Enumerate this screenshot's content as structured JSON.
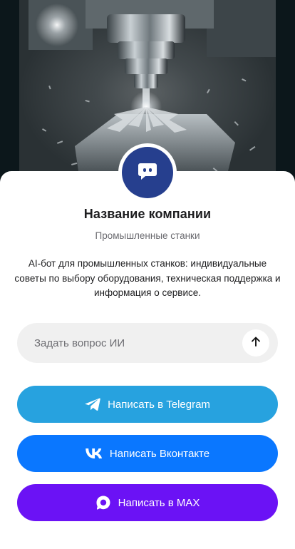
{
  "profile": {
    "company_name": "Название компании",
    "subtitle": "Промышленные станки",
    "description": "AI-бот для промышленных станков: индивидуальные советы по выбору оборудования, техническая поддержка и информация о сервисе.",
    "avatar_icon": "chat-bot-icon"
  },
  "hero": {
    "image": "cnc-milling-machine-photo"
  },
  "ask": {
    "placeholder": "Задать вопрос ИИ",
    "value": "",
    "send_icon": "arrow-up-icon"
  },
  "buttons": [
    {
      "label": "Написать в Telegram",
      "icon": "telegram-icon",
      "color": "#27a2df"
    },
    {
      "label": "Написать Вконтакте",
      "icon": "vk-icon",
      "color": "#0a77ff"
    },
    {
      "label": "Написать в MAX",
      "icon": "max-icon",
      "color": "#6b12f5"
    }
  ],
  "colors": {
    "avatar_bg": "#263f8e",
    "card_bg": "#ffffff",
    "input_bg": "#f0f0f0"
  }
}
